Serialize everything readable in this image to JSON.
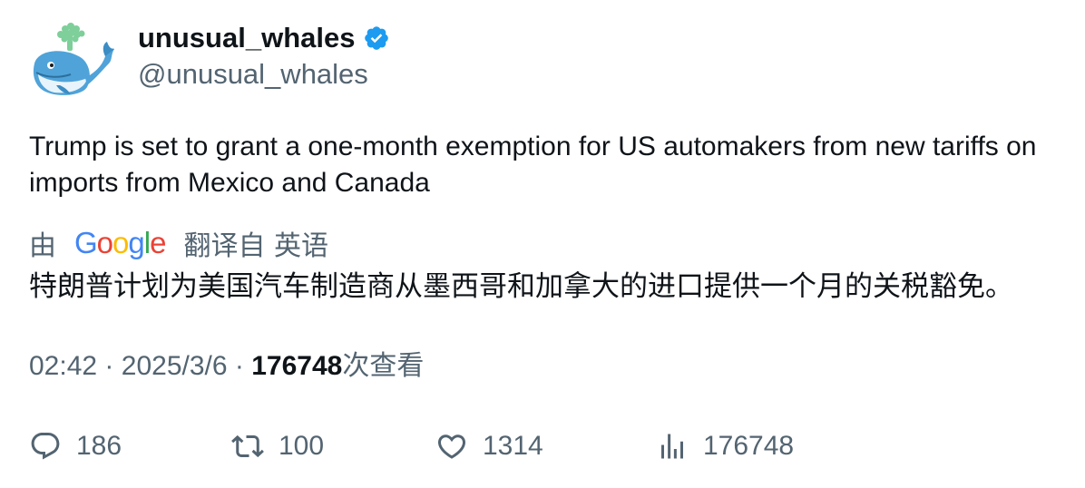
{
  "user": {
    "display_name": "unusual_whales",
    "handle": "@unusual_whales",
    "verified": true,
    "avatar_icon": "whale-avatar"
  },
  "tweet": {
    "text": "Trump is set to grant a one-month exemption for US automakers from new tariffs on imports from Mexico and Canada"
  },
  "translation": {
    "prefix": "由",
    "provider": "Google",
    "suffix": "翻译自 英语",
    "text": "特朗普计划为美国汽车制造商从墨西哥和加拿大的进口提供一个月的关税豁免。"
  },
  "meta": {
    "time": "02:42",
    "separator": "·",
    "date": "2025/3/6",
    "views_count": "176748",
    "views_label": "次查看"
  },
  "actions": {
    "replies": "186",
    "retweets": "100",
    "likes": "1314",
    "views": "176748"
  },
  "colors": {
    "text": "#0f1419",
    "secondary": "#536471",
    "verified": "#1d9bf0",
    "google_blue": "#4285f4",
    "google_red": "#ea4335",
    "google_yellow": "#fbbc05",
    "google_green": "#34a853"
  }
}
